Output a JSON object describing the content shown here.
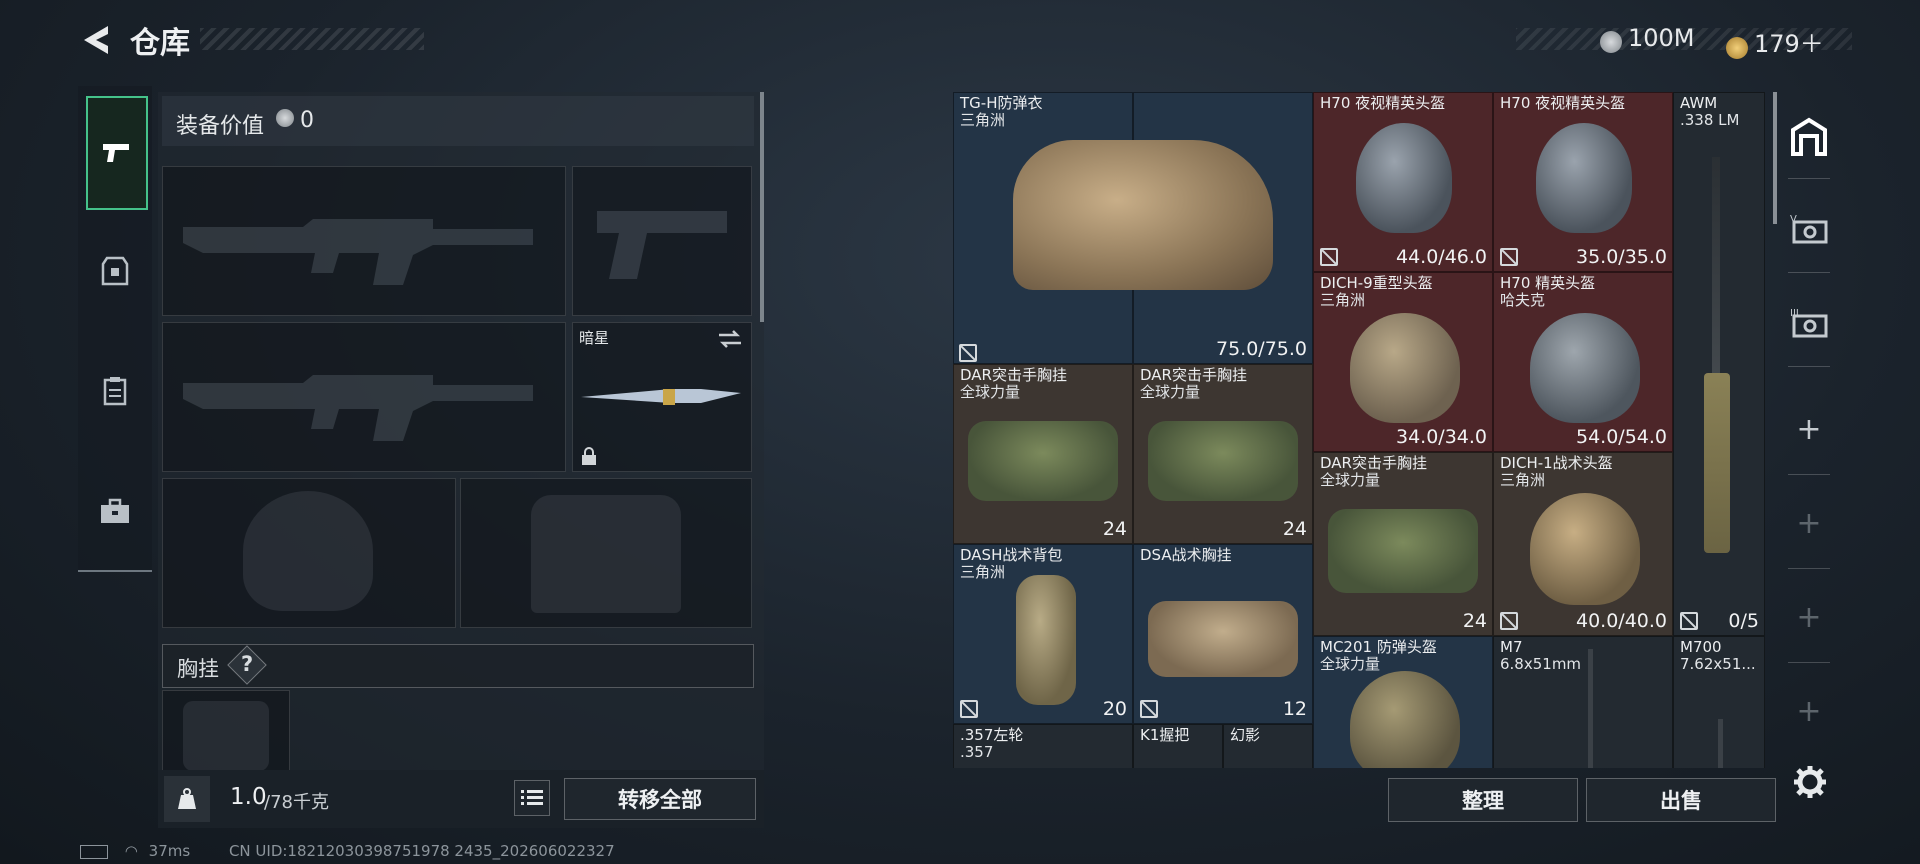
{
  "header": {
    "title": "仓库",
    "currency1": "100M",
    "currency2": "179＋"
  },
  "left": {
    "sidebar_icons": [
      "pistol-icon",
      "armor-icon",
      "clipboard-icon",
      "toolbox-icon"
    ],
    "equip_value_label": "装备价值",
    "equip_value": "0",
    "melee_name": "暗星",
    "chest_rig_label": "胸挂",
    "chest_rig_help": "?",
    "weight": "1.0",
    "weight_max": "/78千克",
    "transfer_all": "转移全部"
  },
  "grid": {
    "items": [
      {
        "name": "TG-H防弹衣",
        "sub": "三角洲",
        "value": "75.0/75.0"
      },
      {
        "name": "H70 夜视精英头盔",
        "sub": "",
        "value": "44.0/46.0"
      },
      {
        "name": "H70 夜视精英头盔",
        "sub": "",
        "value": "35.0/35.0"
      },
      {
        "name": "AWM",
        "sub": ".338 LM",
        "value": "0/5"
      },
      {
        "name": "DICH-9重型头盔",
        "sub": "三角洲",
        "value": "34.0/34.0"
      },
      {
        "name": "H70 精英头盔",
        "sub": "哈夫克",
        "value": "54.0/54.0"
      },
      {
        "name": "DAR突击手胸挂",
        "sub": "全球力量",
        "value": "24"
      },
      {
        "name": "DAR突击手胸挂",
        "sub": "全球力量",
        "value": "24"
      },
      {
        "name": "DAR突击手胸挂",
        "sub": "全球力量",
        "value": "24"
      },
      {
        "name": "DICH-1战术头盔",
        "sub": "三角洲",
        "value": "40.0/40.0"
      },
      {
        "name": "DASH战术背包",
        "sub": "三角洲",
        "value": "20"
      },
      {
        "name": "DSA战术胸挂",
        "sub": "",
        "value": "12"
      },
      {
        "name": "MC201 防弹头盔",
        "sub": "全球力量",
        "value": ""
      },
      {
        "name": "M7",
        "sub": "6.8x51mm",
        "value": ""
      },
      {
        "name": "M700",
        "sub": "7.62x51...",
        "value": ""
      },
      {
        "name": ".357左轮",
        "sub": ".357",
        "value": ""
      },
      {
        "name": "K1握把",
        "sub": "",
        "value": ""
      },
      {
        "name": "幻影",
        "sub": "",
        "value": ""
      }
    ]
  },
  "buttons": {
    "sort": "整理",
    "sell": "出售"
  },
  "status": {
    "ping": "37ms",
    "uid": "CN UID:18212030398751978 2435_202606022327"
  },
  "colors": {
    "accent_green": "#45c28a",
    "cell_red": "#4d2629",
    "cell_blue": "#233446",
    "cell_brown": "#3d3631"
  }
}
